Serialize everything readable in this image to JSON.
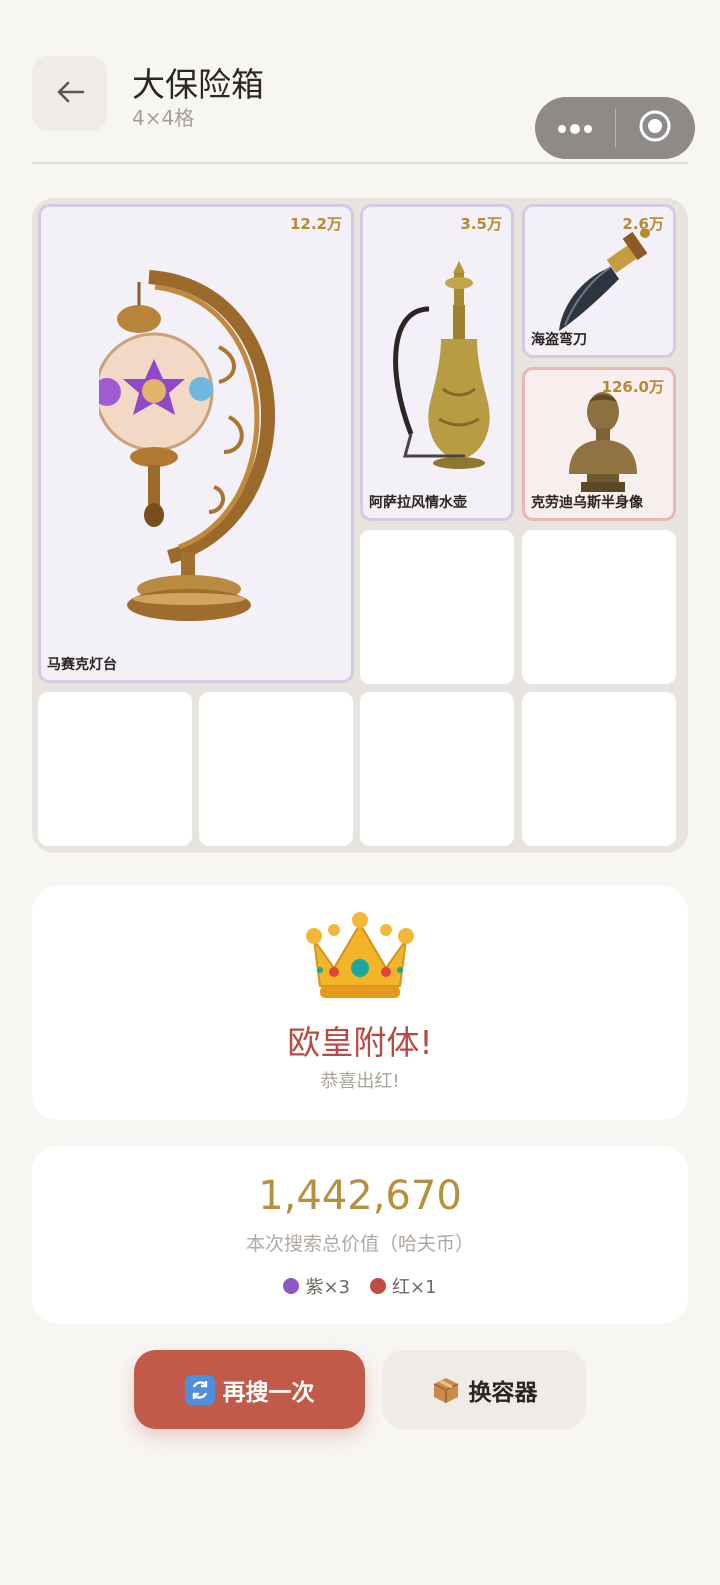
{
  "header": {
    "title": "大保险箱",
    "subtitle": "4×4格"
  },
  "grid": {
    "items": [
      {
        "name": "马赛克灯台",
        "price": "12.2万",
        "rarity": "purple"
      },
      {
        "name": "阿萨拉风情水壶",
        "price": "3.5万",
        "rarity": "purple"
      },
      {
        "name": "海盗弯刀",
        "price": "2.6万",
        "rarity": "purple"
      },
      {
        "name": "克劳迪乌斯半身像",
        "price": "126.0万",
        "rarity": "red"
      }
    ]
  },
  "result": {
    "icon": "crown-icon",
    "title": "欧皇附体!",
    "subtitle": "恭喜出红!"
  },
  "summary": {
    "total_value": "1,442,670",
    "total_label": "本次搜索总价值（哈夫币）",
    "counts": [
      {
        "label": "紫×3",
        "color": "#9158c4"
      },
      {
        "label": "红×1",
        "color": "#c24a44"
      }
    ]
  },
  "actions": {
    "search_again": "再搜一次",
    "change_container": "换容器"
  },
  "colors": {
    "accent_red": "#c25a4a",
    "gold": "#b5913f",
    "purple_rarity": "#d6cae6",
    "red_rarity": "#e5b9b5"
  }
}
